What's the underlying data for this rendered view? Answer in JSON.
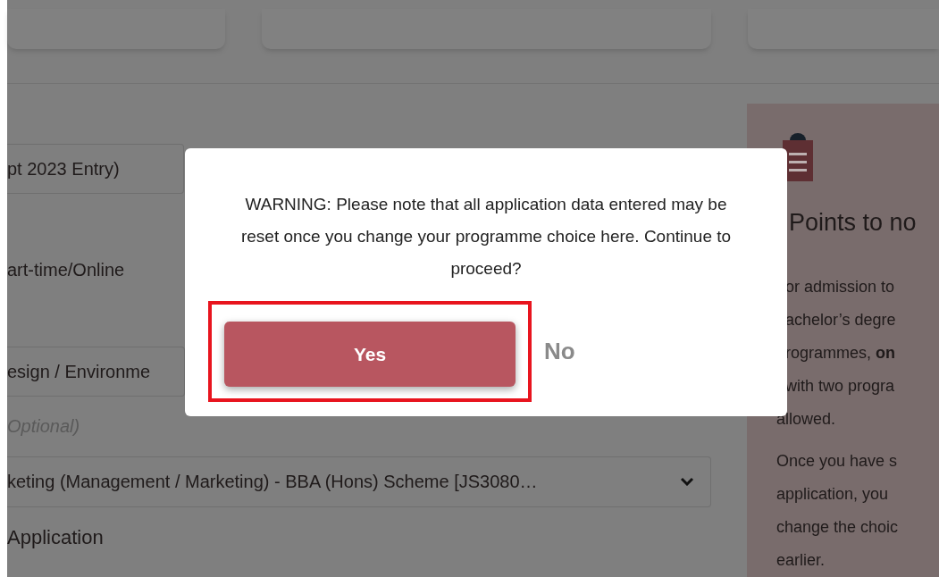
{
  "form": {
    "intake_field": {
      "value": "pt 2023 Entry)"
    },
    "study_mode": "art-time/Online",
    "choice_field": {
      "value": "esign / Environme"
    },
    "optional_label": "Optional)",
    "second_choice_select": {
      "value": "keting (Management / Marketing) - BBA (Hons) Scheme [JS3080…"
    },
    "section_heading": "Application"
  },
  "points_panel": {
    "heading": "Points to no",
    "paragraph_1": {
      "covered_lines": [
        "or admission to",
        "achelor’s degre",
        "rogrammes, **on**",
        "with two progra"
      ],
      "lines": [
        "allowed."
      ]
    },
    "paragraph_2": {
      "lines": [
        "Once you have s",
        "application, you",
        "change the choic",
        "earlier."
      ]
    }
  },
  "dialog": {
    "message": "WARNING: Please note that all application data entered may be reset once you change your programme choice here. Continue to proceed?",
    "buttons": [
      {
        "label": "Yes",
        "kind": "primary",
        "highlighted": true
      },
      {
        "label": "No",
        "kind": "link",
        "highlighted": false
      }
    ]
  }
}
